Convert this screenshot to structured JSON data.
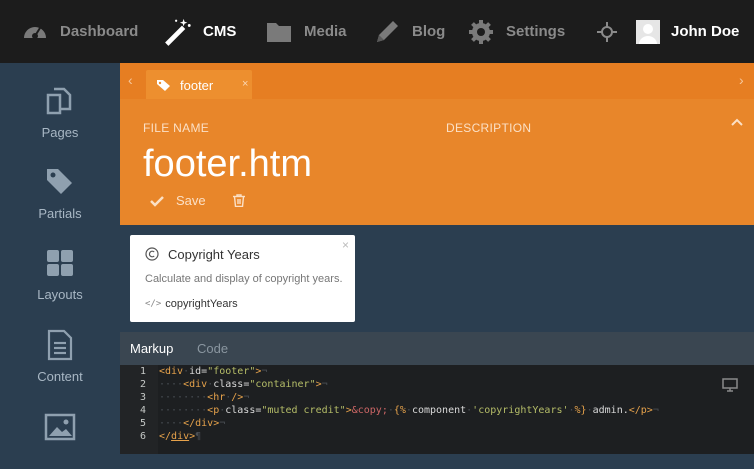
{
  "topnav": {
    "items": [
      {
        "label": "Dashboard",
        "icon": "dashboard-icon"
      },
      {
        "label": "CMS",
        "icon": "wand-icon",
        "active": true
      },
      {
        "label": "Media",
        "icon": "folder-icon"
      },
      {
        "label": "Blog",
        "icon": "pencil-icon"
      },
      {
        "label": "Settings",
        "icon": "gear-icon"
      }
    ],
    "user_name": "John Doe"
  },
  "sidebar": {
    "items": [
      {
        "label": "Pages",
        "icon": "pages-icon"
      },
      {
        "label": "Partials",
        "icon": "tags-icon"
      },
      {
        "label": "Layouts",
        "icon": "grid-icon"
      },
      {
        "label": "Content",
        "icon": "document-icon"
      },
      {
        "label": "",
        "icon": "image-icon"
      }
    ]
  },
  "tab": {
    "label": "footer",
    "close": "×"
  },
  "header": {
    "file_name_label": "FILE NAME",
    "description_label": "DESCRIPTION",
    "file_name": "footer.htm",
    "save_label": "Save"
  },
  "component": {
    "title": "Copyright Years",
    "description": "Calculate and display of copyright years.",
    "alias": "copyrightYears",
    "code_icon": "</>",
    "close": "×"
  },
  "editor_tabs": {
    "markup": "Markup",
    "code": "Code"
  },
  "code": {
    "line_numbers": [
      "1",
      "2",
      "3",
      "4",
      "5",
      "6"
    ],
    "l1a": "<div",
    "l1b": "id",
    "l1c": "=",
    "l1d": "\"footer\"",
    "l1e": ">",
    "l1f": "¬",
    "l2a": "····",
    "l2b": "<div",
    "l2c": "class",
    "l2d": "=",
    "l2e": "\"container\"",
    "l2f": ">",
    "l2g": "¬",
    "l3a": "········",
    "l3b": "<hr",
    "l3c": "/>",
    "l3d": "¬",
    "l4a": "········",
    "l4b": "<p",
    "l4c": "class",
    "l4d": "=",
    "l4e": "\"muted credit\"",
    "l4f": ">",
    "l4g": "&copy;",
    "l4h": "{%",
    "l4i": "component",
    "l4j": "'copyrightYears'",
    "l4k": "%}",
    "l4l": "admin.",
    "l4m": "</p>",
    "l4n": "¬",
    "l5a": "····",
    "l5b": "</div>",
    "l5c": "¬",
    "l6a": "</",
    "l6b": "div",
    "l6c": ">",
    "l6d": "¶"
  },
  "colors": {
    "accent": "#e67e22",
    "topbar": "#1c1c1c",
    "sidebar": "#2b3e50"
  }
}
